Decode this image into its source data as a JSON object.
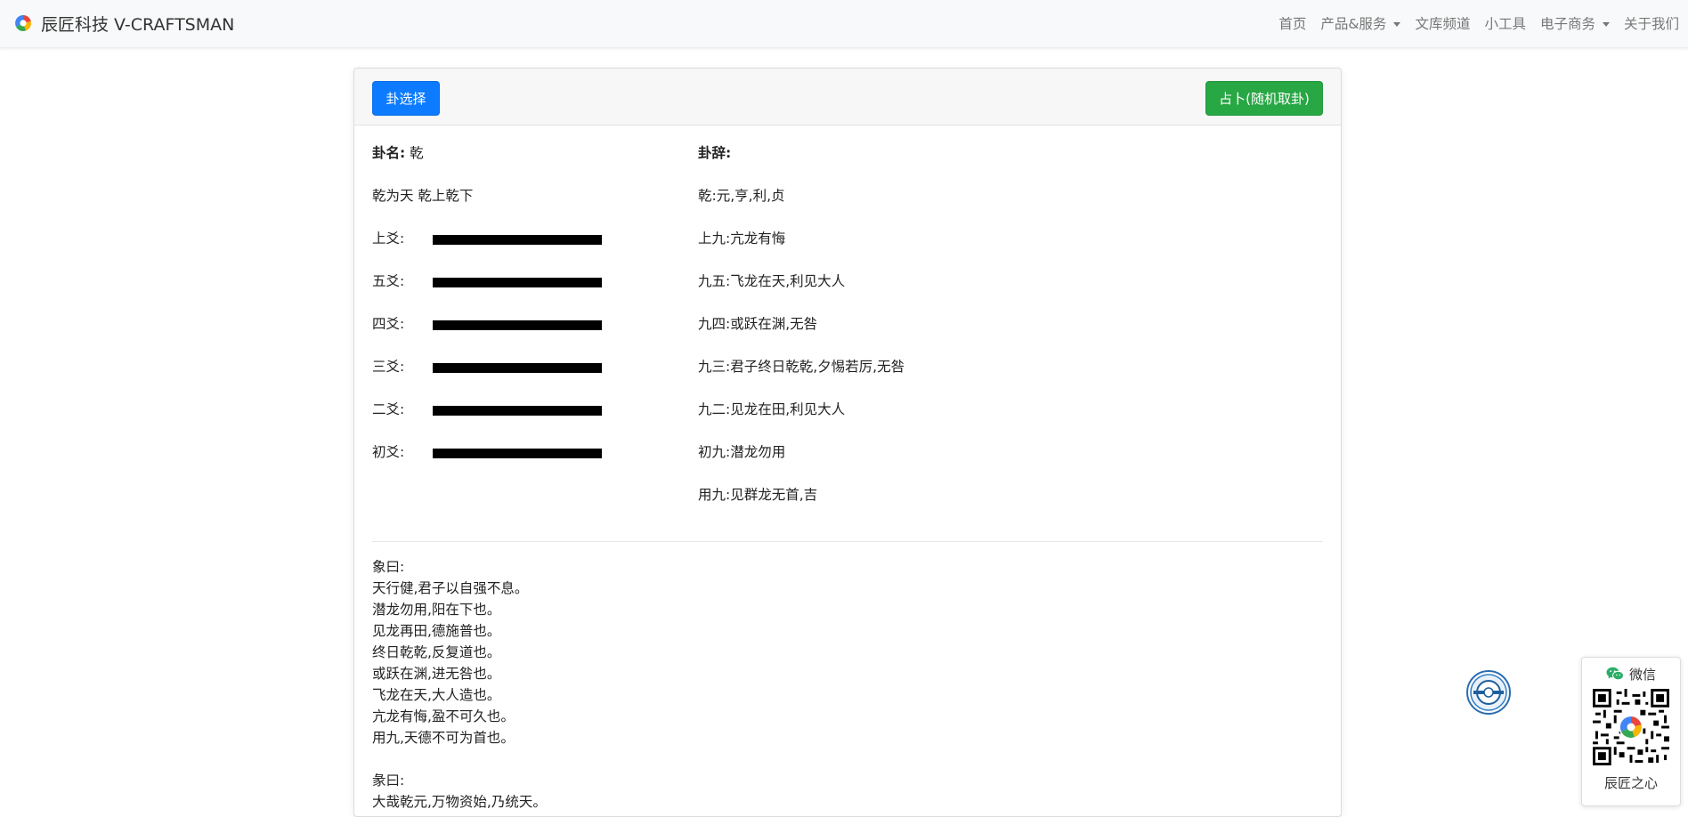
{
  "navbar": {
    "brand": "辰匠科技 V-CRAFTSMAN",
    "items": [
      {
        "label": "首页",
        "dropdown": false
      },
      {
        "label": "产品&服务",
        "dropdown": true
      },
      {
        "label": "文库频道",
        "dropdown": false
      },
      {
        "label": "小工具",
        "dropdown": false
      },
      {
        "label": "电子商务",
        "dropdown": true
      },
      {
        "label": "关于我们",
        "dropdown": false
      }
    ]
  },
  "card": {
    "select_button": "卦选择",
    "divine_button": "占卜(随机取卦)",
    "gua_name_label": "卦名:",
    "gua_name": "乾",
    "gua_full": "乾为天 乾上乾下",
    "yao": [
      {
        "label": "上爻:",
        "type": "yang"
      },
      {
        "label": "五爻:",
        "type": "yang"
      },
      {
        "label": "四爻:",
        "type": "yang"
      },
      {
        "label": "三爻:",
        "type": "yang"
      },
      {
        "label": "二爻:",
        "type": "yang"
      },
      {
        "label": "初爻:",
        "type": "yang"
      }
    ],
    "guaci_label": "卦辞:",
    "guaci_lines": [
      "乾:元,亨,利,贞",
      "上九:亢龙有悔",
      "九五:飞龙在天,利见大人",
      "九四:或跃在渊,无咎",
      "九三:君子终日乾乾,夕惕若厉,无咎",
      "九二:见龙在田,利见大人",
      "初九:潜龙勿用",
      "用九:见群龙无首,吉"
    ],
    "xiang_lines": [
      "象曰:",
      "天行健,君子以自强不息。",
      "潜龙勿用,阳在下也。",
      "见龙再田,德施普也。",
      "终日乾乾,反复道也。",
      "或跃在渊,进无咎也。",
      "飞龙在天,大人造也。",
      "亢龙有悔,盈不可久也。",
      "用九,天德不可为首也。",
      "",
      "彖曰:",
      "大哉乾元,万物资始,乃统天。"
    ]
  },
  "wechat": {
    "title": "微信",
    "caption": "辰匠之心"
  },
  "colors": {
    "primary": "#0d7bff",
    "success": "#28a745",
    "navbar_bg": "#f8f9fa",
    "wechat_green": "#2aae67"
  }
}
